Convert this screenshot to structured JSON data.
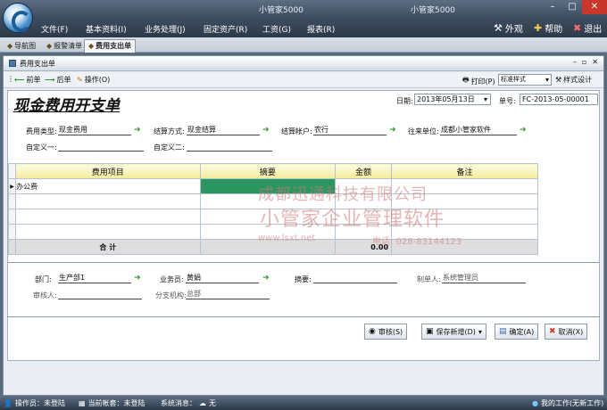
{
  "window": {
    "title_left": "小管家5000",
    "title_right": "小管家5000",
    "controls": [
      "–",
      "□",
      "✕"
    ]
  },
  "menu": {
    "items": [
      "文件(F)",
      "基本资料(I)",
      "业务处理(J)",
      "固定资产(R)",
      "工资(G)",
      "报表(R)"
    ],
    "right": [
      {
        "icon": "tools-icon",
        "label": "外观"
      },
      {
        "icon": "help-icon",
        "label": "帮助"
      },
      {
        "icon": "exit-icon",
        "label": "退出"
      }
    ]
  },
  "tabs": [
    {
      "label": "导航图",
      "active": false
    },
    {
      "label": "报警清单",
      "active": false
    },
    {
      "label": "费用支出单",
      "active": true
    }
  ],
  "doc": {
    "window_title": "费用支出单",
    "toolbar": {
      "prev": "前单",
      "next": "后单",
      "ops": "操作(O)",
      "print": "打印(P)",
      "style_select": "标准样式",
      "style_design": "样式设计"
    },
    "title": "现金费用开支单",
    "date_label": "日期:",
    "date_value": "2013年05月13日",
    "no_label": "单号:",
    "no_value": "FC-2013-05-00001",
    "fields": {
      "type_label": "费用类型:",
      "type_value": "现金费用",
      "settle_label": "结算方式:",
      "settle_value": "现金结算",
      "account_label": "结算帐户:",
      "account_value": "农行",
      "unit_label": "往来单位:",
      "unit_value": "成都小管家软件",
      "custom1_label": "自定义一:",
      "custom2_label": "自定义二:"
    },
    "grid": {
      "headers": [
        "费用项目",
        "摘要",
        "金额",
        "备注"
      ],
      "rows": [
        [
          "办公费",
          "",
          "",
          ""
        ],
        [
          "",
          "",
          "",
          ""
        ],
        [
          "",
          "",
          "",
          ""
        ],
        [
          "",
          "",
          "",
          ""
        ]
      ],
      "total_label": "合 计",
      "total_amount": "0.00"
    },
    "watermark": {
      "company": "成都迅通科技有限公司",
      "product": "小管家企业管理软件",
      "site": "www.lsxt.net",
      "phone": "电话: 028-83144123"
    },
    "footer": {
      "dept_label": "部门:",
      "dept_value": "生产部1",
      "clerk_label": "业务员:",
      "clerk_value": "黄娟",
      "summary_label": "摘要:",
      "maker_label": "制单人:",
      "maker_value": "系统管理员",
      "auditor_label": "审核人:",
      "branch_label": "分支机构:",
      "branch_value": "总部"
    },
    "buttons": {
      "audit": "审核(S)",
      "save_new": "保存新增(D)",
      "ok": "确定(A)",
      "cancel": "取消(X)"
    }
  },
  "status": {
    "operator": "操作员：未登陆",
    "account": "当前帐套：未登陆",
    "sysmsg": "系统消息：",
    "sysmsg_value": "无",
    "mywork": "我的工作(无新工作)"
  }
}
